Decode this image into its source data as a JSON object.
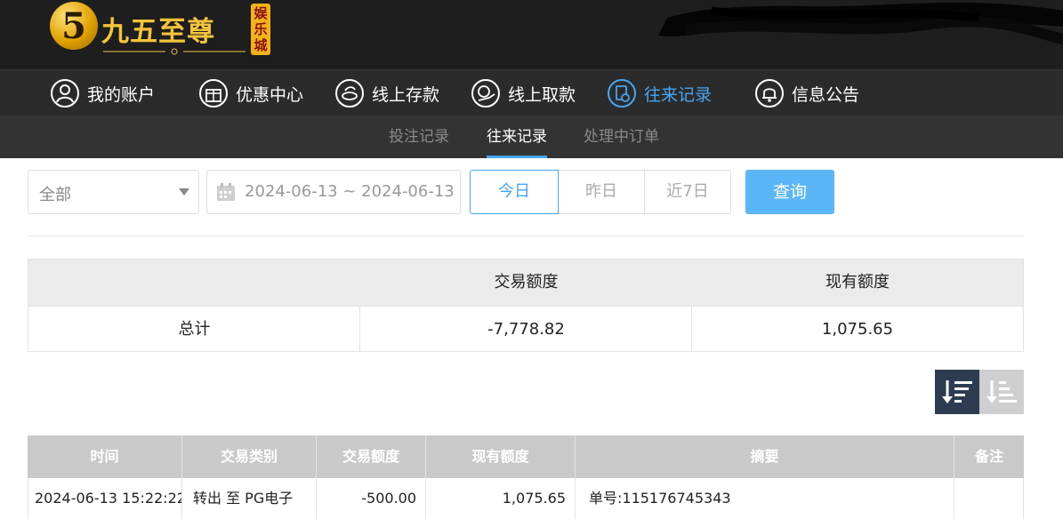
{
  "brand": {
    "logo_numeral": "5",
    "name": "九五至尊",
    "badge": "娱乐城"
  },
  "nav": {
    "items": [
      {
        "label": "我的账户",
        "icon": "user-icon"
      },
      {
        "label": "优惠中心",
        "icon": "gift-icon"
      },
      {
        "label": "线上存款",
        "icon": "deposit-icon"
      },
      {
        "label": "线上取款",
        "icon": "withdraw-icon"
      },
      {
        "label": "往来记录",
        "icon": "records-icon",
        "active": true
      },
      {
        "label": "信息公告",
        "icon": "bell-icon"
      }
    ],
    "active_color": "#46a6f2"
  },
  "subtabs": [
    {
      "label": "投注记录"
    },
    {
      "label": "往来记录",
      "active": true
    },
    {
      "label": "处理中订单"
    }
  ],
  "filters": {
    "type_select": {
      "value": "全部"
    },
    "date_range": {
      "value": "2024-06-13 ~ 2024-06-13"
    },
    "quick_ranges": [
      "今日",
      "昨日",
      "近7日"
    ],
    "selected_range": "今日",
    "search_label": "查询"
  },
  "summary": {
    "headers": [
      "",
      "交易额度",
      "现有额度"
    ],
    "total_label": "总计",
    "total_transaction": "-7,778.82",
    "total_balance": "1,075.65"
  },
  "sort": {
    "desc_icon": "sort-desc-icon",
    "asc_icon": "sort-asc-icon",
    "active": "desc"
  },
  "records": {
    "headers": [
      "时间",
      "交易类别",
      "交易额度",
      "现有额度",
      "摘要",
      "备注"
    ],
    "rows": [
      {
        "time": "2024-06-13 15:22:22",
        "type": "转出 至 PG电子",
        "amount": "-500.00",
        "balance": "1,075.65",
        "summary": "单号:115176745343",
        "note": ""
      }
    ]
  },
  "colors": {
    "accent": "#46a6f2",
    "header_bg": "#1e1e1e",
    "navbar_bg": "#2b2b2b",
    "subbar_bg": "#333333",
    "search_btn": "#5ab6f7",
    "sort_active": "#2d3c50"
  }
}
